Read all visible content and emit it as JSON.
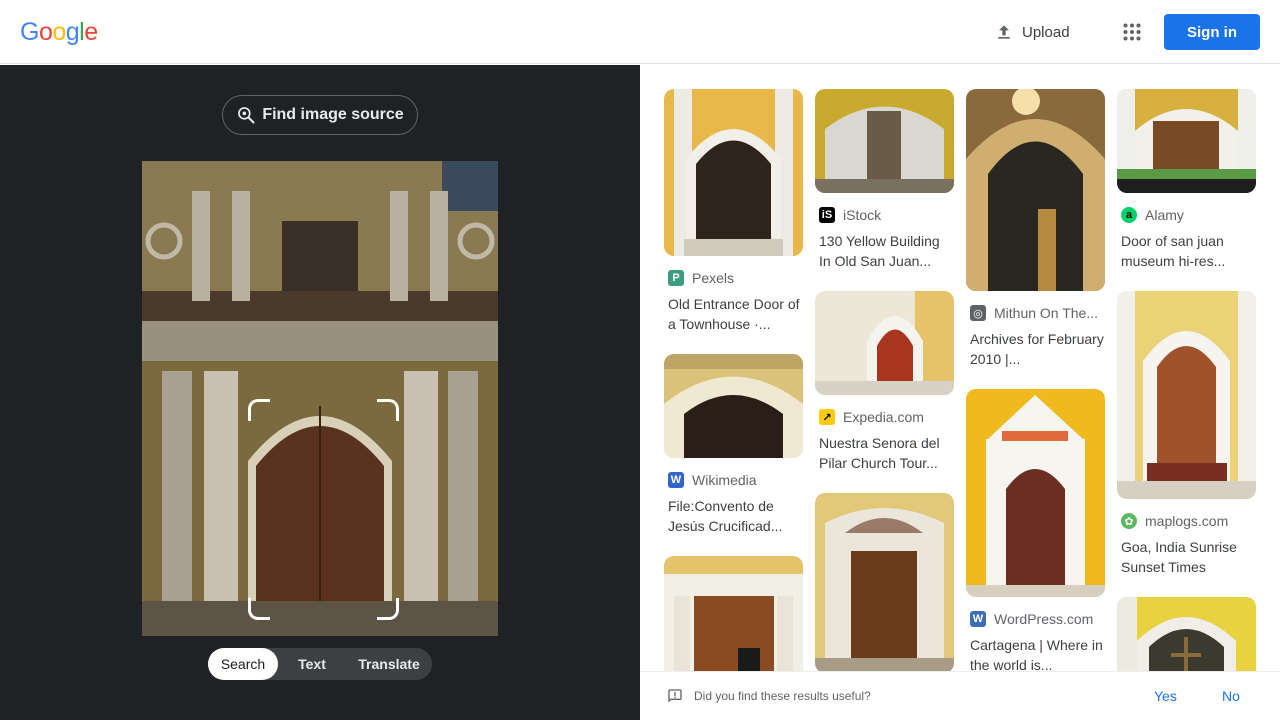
{
  "header": {
    "logo_letters": [
      "G",
      "o",
      "o",
      "g",
      "l",
      "e"
    ],
    "upload_label": "Upload",
    "signin_label": "Sign in"
  },
  "lens": {
    "find_source_label": "Find image source",
    "modes": [
      "Search",
      "Text",
      "Translate"
    ],
    "active_mode": "Search"
  },
  "results": {
    "columns": [
      [
        {
          "source": "Pexels",
          "title": "Old Entrance Door of a Townhouse ·...",
          "favicon": "P",
          "favicon_color": "#3d9c7f"
        },
        {
          "source": "Wikimedia",
          "title": "File:Convento de Jesús Crucificad...",
          "favicon": "W",
          "favicon_color": "#3366cc"
        },
        {
          "source": "",
          "title": "",
          "favicon": "",
          "favicon_color": "#ffffff"
        }
      ],
      [
        {
          "source": "iStock",
          "title": "130 Yellow Building In Old San Juan...",
          "favicon": "iS",
          "favicon_color": "#000000"
        },
        {
          "source": "Expedia.com",
          "title": "Nuestra Senora del Pilar Church Tour...",
          "favicon": "↗",
          "favicon_color": "#fccc0a"
        },
        {
          "source": "",
          "title": "",
          "favicon": "",
          "favicon_color": "#ffffff"
        }
      ],
      [
        {
          "source": "Mithun On The...",
          "title": "Archives for February 2010 |...",
          "favicon": "◎",
          "favicon_color": "#5f6368"
        },
        {
          "source": "WordPress.com",
          "title": "Cartagena | Where in the world is...",
          "favicon": "W",
          "favicon_color": "#3c6fb5"
        }
      ],
      [
        {
          "source": "Alamy",
          "title": "Door of san juan museum hi-res...",
          "favicon": "a",
          "favicon_color": "#00d26a"
        },
        {
          "source": "maplogs.com",
          "title": "Goa, India Sunrise Sunset Times",
          "favicon": "✿",
          "favicon_color": "#5cb85c"
        },
        {
          "source": "",
          "title": "",
          "favicon": "",
          "favicon_color": "#ffffff"
        }
      ]
    ]
  },
  "feedback": {
    "question": "Did you find these results useful?",
    "yes_label": "Yes",
    "no_label": "No"
  },
  "colors": {
    "accent": "#1a73e8",
    "panel_bg": "#202124",
    "logo": [
      "#4285f4",
      "#ea4335",
      "#fbbc05",
      "#4285f4",
      "#34a853",
      "#ea4335"
    ]
  }
}
